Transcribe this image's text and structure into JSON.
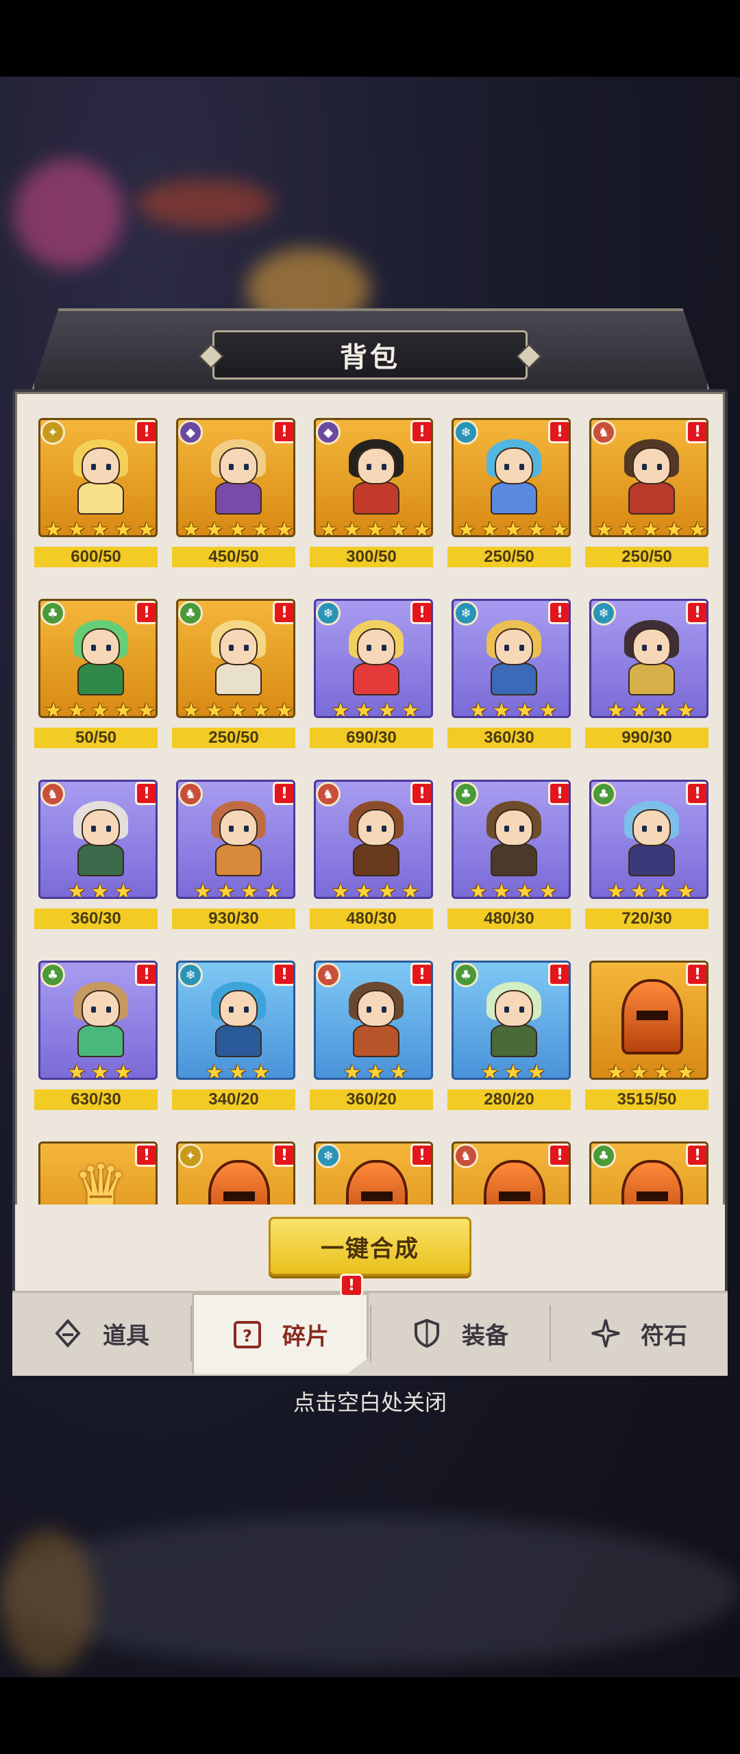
{
  "backpack": {
    "title": "背包"
  },
  "cards": [
    {
      "element": "gold",
      "frame": "gold",
      "stars": 5,
      "count": "600/50",
      "hair": "#f3d35a",
      "body": "#f6e08a"
    },
    {
      "element": "purple",
      "frame": "gold",
      "stars": 5,
      "count": "450/50",
      "hair": "#f1d08a",
      "body": "#7a4aa8"
    },
    {
      "element": "purple",
      "frame": "gold",
      "stars": 5,
      "count": "300/50",
      "hair": "#1a1a1e",
      "body": "#c23a2a"
    },
    {
      "element": "teal",
      "frame": "gold",
      "stars": 5,
      "count": "250/50",
      "hair": "#4ab6ea",
      "body": "#5a8ae0"
    },
    {
      "element": "red",
      "frame": "gold",
      "stars": 5,
      "count": "250/50",
      "hair": "#4a3226",
      "body": "#b83a2a"
    },
    {
      "element": "green",
      "frame": "gold",
      "stars": 5,
      "count": "50/50",
      "hair": "#5ed07a",
      "body": "#2f8a4a"
    },
    {
      "element": "green",
      "frame": "gold",
      "stars": 5,
      "count": "250/50",
      "hair": "#f4da8a",
      "body": "#e8e0c8"
    },
    {
      "element": "teal",
      "frame": "purple",
      "stars": 4,
      "count": "690/30",
      "hair": "#f5d35a",
      "body": "#e43a3a"
    },
    {
      "element": "teal",
      "frame": "purple",
      "stars": 4,
      "count": "360/30",
      "hair": "#f1c24a",
      "body": "#3a6ab8"
    },
    {
      "element": "teal",
      "frame": "purple",
      "stars": 4,
      "count": "990/30",
      "hair": "#3a2a2a",
      "body": "#d8b04a"
    },
    {
      "element": "red",
      "frame": "purple",
      "stars": 3,
      "count": "360/30",
      "hair": "#e8e4dc",
      "body": "#3a6a4a"
    },
    {
      "element": "red",
      "frame": "purple",
      "stars": 4,
      "count": "930/30",
      "hair": "#c26a3a",
      "body": "#d88a3a"
    },
    {
      "element": "red",
      "frame": "purple",
      "stars": 4,
      "count": "480/30",
      "hair": "#8a4a1e",
      "body": "#6a3a1e"
    },
    {
      "element": "green",
      "frame": "purple",
      "stars": 4,
      "count": "480/30",
      "hair": "#6a4a22",
      "body": "#4a3a2a"
    },
    {
      "element": "green",
      "frame": "purple",
      "stars": 4,
      "count": "720/30",
      "hair": "#7ac2ea",
      "body": "#3a3a7a"
    },
    {
      "element": "green",
      "frame": "purple",
      "stars": 3,
      "count": "630/30",
      "hair": "#c89a5a",
      "body": "#4ab87a"
    },
    {
      "element": "teal",
      "frame": "blue",
      "stars": 3,
      "count": "340/20",
      "hair": "#3aa2da",
      "body": "#2a5a9a"
    },
    {
      "element": "red",
      "frame": "blue",
      "stars": 3,
      "count": "360/20",
      "hair": "#6a4226",
      "body": "#b8542a"
    },
    {
      "element": "green",
      "frame": "blue",
      "stars": 3,
      "count": "280/20",
      "hair": "#d8f0c0",
      "body": "#4a6a3a"
    },
    {
      "element": "none",
      "frame": "gold",
      "stars": 4,
      "count": "3515/50",
      "type": "helmet"
    },
    {
      "element": "none",
      "frame": "gold",
      "stars": 0,
      "count": "",
      "type": "crown"
    },
    {
      "element": "gold",
      "frame": "gold",
      "stars": 0,
      "count": "",
      "type": "helmet"
    },
    {
      "element": "teal",
      "frame": "gold",
      "stars": 0,
      "count": "",
      "type": "helmet"
    },
    {
      "element": "red",
      "frame": "gold",
      "stars": 0,
      "count": "",
      "type": "helmet"
    },
    {
      "element": "green",
      "frame": "gold",
      "stars": 0,
      "count": "",
      "type": "helmet"
    }
  ],
  "compose_button": "一键合成",
  "tabs": [
    {
      "label": "道具",
      "icon": "potion-icon",
      "active": false
    },
    {
      "label": "碎片",
      "icon": "question-box-icon",
      "active": true
    },
    {
      "label": "装备",
      "icon": "shield-icon",
      "active": false
    },
    {
      "label": "符石",
      "icon": "rune-star-icon",
      "active": false
    }
  ],
  "alert_mark": "!",
  "close_hint": "点击空白处关闭"
}
